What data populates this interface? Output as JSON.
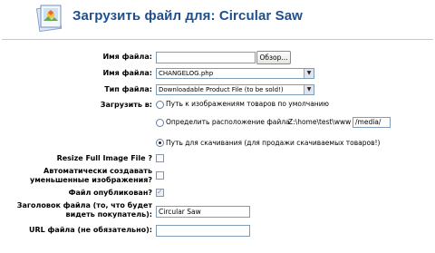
{
  "page": {
    "title": "Загрузить файл для: Circular Saw"
  },
  "form": {
    "file_name_label": "Имя файла:",
    "browse_button": "Обзор...",
    "file_name_select_label": "Имя файла:",
    "file_name_selected": "CHANGELOG.php",
    "file_type_label": "Тип файла:",
    "file_type_selected": "Downloadable Product File (to be sold!)",
    "upload_to_label": "Загрузить в:",
    "upload_options": [
      "Путь к изображениям товаров по умолчанию",
      "Определить расположение файла:",
      "Путь для скачивания (для продажи скачиваемых товаров!)"
    ],
    "custom_path_prefix": "Z:\\home\\test\\www",
    "custom_path_value": "/media/",
    "resize_label": "Resize Full Image File ?",
    "auto_thumb_label": "Автоматически создавать уменьшенные изображения?",
    "published_label": "Файл опубликован?",
    "file_title_label": "Заголовок файла (то, что будет видеть покупатель):",
    "file_title_value": "Circular Saw",
    "file_url_label": "URL файла (не обязательно):",
    "file_url_value": ""
  }
}
